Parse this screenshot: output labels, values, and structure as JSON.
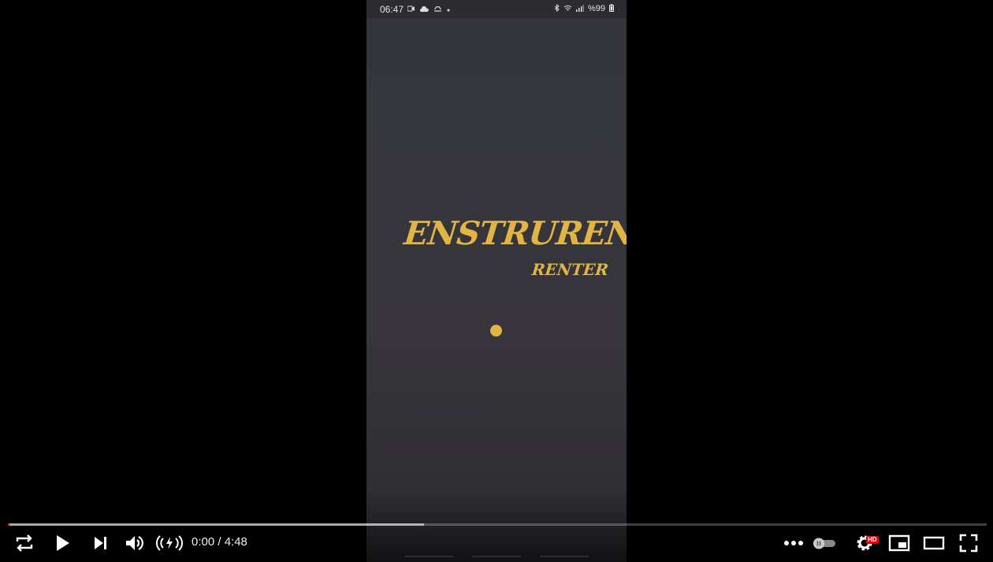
{
  "status_bar": {
    "time": "06:47",
    "battery": "%99",
    "left_icons": [
      "video-record-icon",
      "cloud-icon",
      "weather-icon",
      "dot-icon"
    ],
    "right_icons": [
      "bluetooth-icon",
      "wifi-icon",
      "signal-icon",
      "battery-icon"
    ]
  },
  "app": {
    "title": "ENSTRURENT",
    "subtitle": "RENTER",
    "accent_color": "#e0b545",
    "background_color": "#35353b"
  },
  "player": {
    "time_display": "0:00 / 4:48",
    "progress_played_fraction": 0.0,
    "buffered_fraction": 0.425,
    "hd_badge": "HD",
    "controls_left": [
      "loop-icon",
      "play-icon",
      "next-icon",
      "volume-icon",
      "stable-volume-icon"
    ],
    "controls_right": [
      "more-icon",
      "autoplay-toggle",
      "settings-icon",
      "miniplayer-icon",
      "theater-icon",
      "fullscreen-icon"
    ]
  }
}
